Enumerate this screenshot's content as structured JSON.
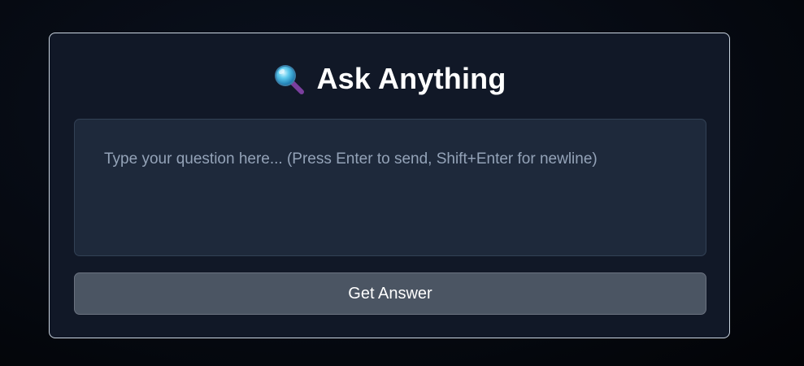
{
  "header": {
    "icon": "magnifying-glass-icon",
    "title": "Ask Anything"
  },
  "question": {
    "value": "",
    "placeholder": "Type your question here... (Press Enter to send, Shift+Enter for newline)"
  },
  "submit": {
    "label": "Get Answer"
  },
  "colors": {
    "card_background": "#111827",
    "card_border": "#cbd5e1",
    "input_background": "#1e293b",
    "button_background": "#4b5563"
  }
}
